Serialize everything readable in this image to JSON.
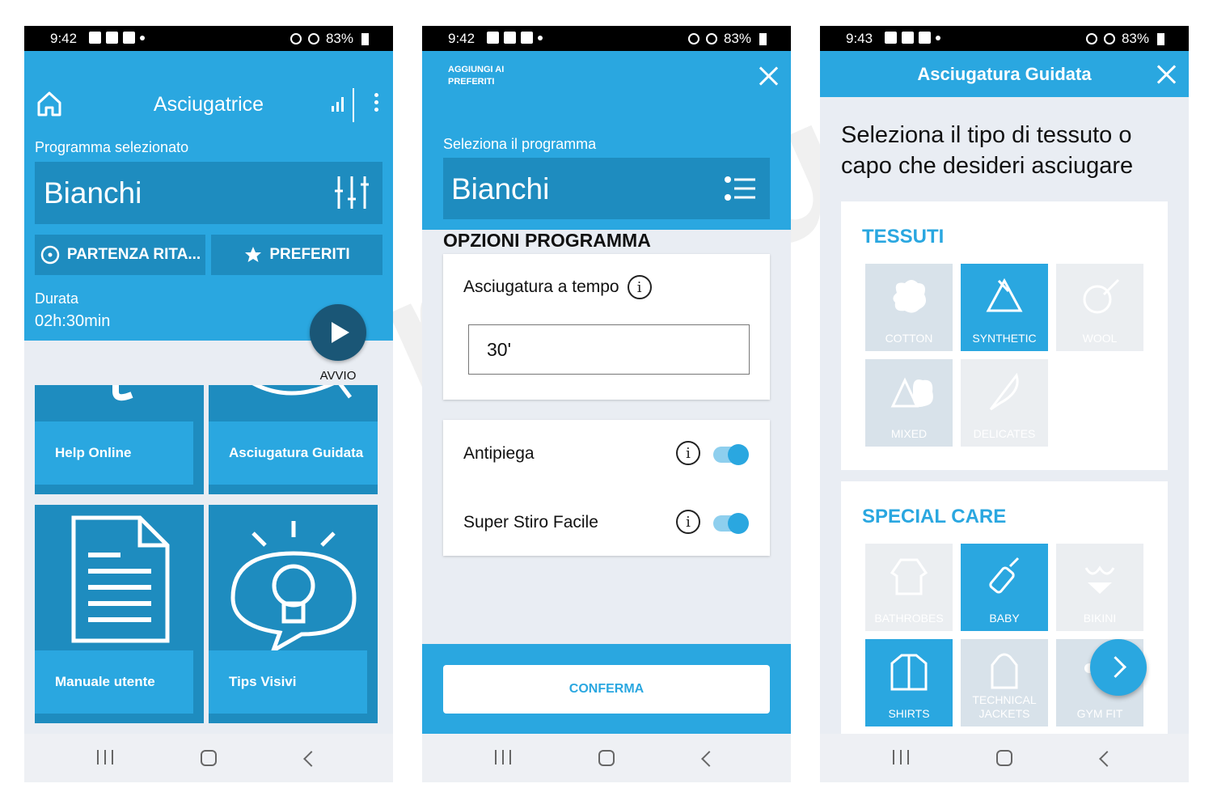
{
  "phone1": {
    "status": {
      "time": "9:42",
      "battery": "83%"
    },
    "header": {
      "title": "Asciugatrice"
    },
    "program_label": "Programma selezionato",
    "program_name": "Bianchi",
    "delay_button": "PARTENZA RITA...",
    "favorites_button": "PREFERITI",
    "duration_label": "Durata",
    "duration_value": "02h:30min",
    "start_label": "AVVIO",
    "tiles": [
      "Help Online",
      "Asciugatura Guidata",
      "Manuale utente",
      "Tips Visivi"
    ]
  },
  "phone2": {
    "status": {
      "time": "9:42",
      "battery": "83%"
    },
    "add_favorites": "AGGIUNGI AI PREFERITI",
    "select_label": "Seleziona il programma",
    "program_name": "Bianchi",
    "options_title": "OPZIONI PROGRAMMA",
    "timed_label": "Asciugatura a tempo",
    "timed_value": "30'",
    "antipiega_label": "Antipiega",
    "antipiega_on": true,
    "stiro_label": "Super Stiro Facile",
    "stiro_on": true,
    "confirm_button": "CONFERMA"
  },
  "phone3": {
    "status": {
      "time": "9:43",
      "battery": "83%"
    },
    "header": {
      "title": "Asciugatura Guidata"
    },
    "intro": "Seleziona il tipo di tessuto o capo che desideri asciugare",
    "fabrics_title": "TESSUTI",
    "fabrics": [
      {
        "label": "COTTON",
        "state": "available"
      },
      {
        "label": "SYNTHETIC",
        "state": "selected"
      },
      {
        "label": "WOOL",
        "state": "disabled"
      },
      {
        "label": "MIXED",
        "state": "available"
      },
      {
        "label": "DELICATES",
        "state": "disabled"
      }
    ],
    "special_title": "SPECIAL CARE",
    "special": [
      {
        "label": "BATHROBES",
        "state": "disabled"
      },
      {
        "label": "BABY",
        "state": "selected"
      },
      {
        "label": "BIKINI",
        "state": "disabled"
      },
      {
        "label": "SHIRTS",
        "state": "selected"
      },
      {
        "label": "TECHNICAL JACKETS",
        "state": "available"
      },
      {
        "label": "GYM FIT",
        "state": "available"
      }
    ]
  },
  "colors": {
    "primary": "#2aa7e0",
    "primary_dark": "#1e8cbf",
    "play": "#1a5676",
    "background": "#e9edf3"
  },
  "watermark": "@rontum"
}
